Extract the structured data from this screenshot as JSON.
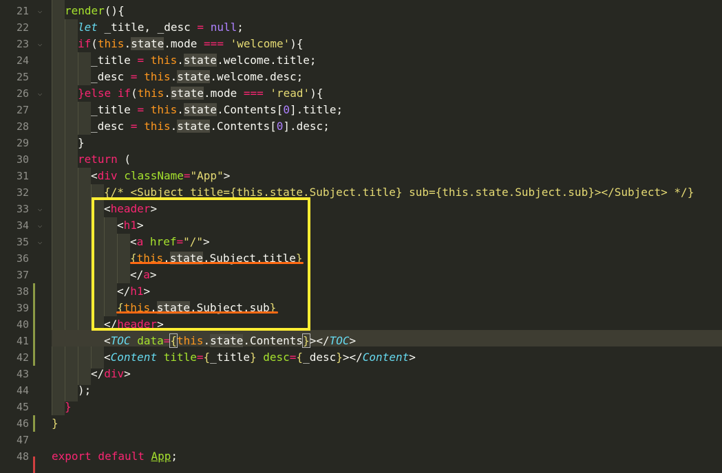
{
  "editor": {
    "theme_colors": {
      "background": "#272822",
      "keyword": "#f92672",
      "function": "#a6e22e",
      "this": "#fd971f",
      "string": "#e6db74",
      "number": "#ae81ff",
      "component": "#66d9ef"
    },
    "line_numbers": [
      "21",
      "22",
      "23",
      "24",
      "25",
      "26",
      "27",
      "28",
      "29",
      "30",
      "31",
      "32",
      "33",
      "34",
      "35",
      "36",
      "37",
      "38",
      "39",
      "40",
      "41",
      "42",
      "43",
      "44",
      "45",
      "46",
      "47",
      "48"
    ],
    "annotations": {
      "highlight_box_color": "#ffee33",
      "underline_color": "#ff6a13"
    },
    "tokens": {
      "render": "render",
      "paren_brace": "(){",
      "let": "let",
      "decl": " _title, _desc ",
      "eq": "=",
      "null": "null",
      "semi": ";",
      "if": "if",
      "paren_open": "(",
      "this": "this",
      "dot": ".",
      "state": "state",
      "mode_seq": ".mode ",
      "strict_eq": "===",
      "welcome_str": "'welcome'",
      "paren_close_brace": "){",
      "title_assign_lhs": "_title ",
      "desc_assign_lhs": "_desc ",
      "welcome_title": ".welcome.title;",
      "welcome_desc": ".welcome.desc;",
      "else_if": "}else if",
      "read_str": "'read'",
      "contents_open": ".Contents[",
      "zero": "0",
      "contents_title": "].title;",
      "contents_desc": "].desc;",
      "close_brace": "}",
      "return": "return",
      "return_paren": " (",
      "lt": "<",
      "gt": ">",
      "div": "div",
      "classname_attr": "className",
      "app_str": "\"App\"",
      "comment_line": "{/* <Subject title={this.state.Subject.title} sub={this.state.Subject.sub}></Subject> */}",
      "header": "header",
      "h1": "h1",
      "a": "a",
      "href_attr": "href",
      "slash_str": "\"/\"",
      "open_brace": "{",
      "subject_title": ".Subject.title",
      "close_tag_open": "</",
      "subject_sub": ".Subject.sub",
      "toc": "TOC",
      "data_attr": "data",
      "contents_plain": ".Contents",
      "content": "Content",
      "title_attr": "title",
      "desc_attr": "desc",
      "title_var": "_title",
      "desc_var": "_desc",
      "close_paren_semi": ");",
      "export_default": "export default ",
      "app_name": "App",
      "space": " "
    }
  }
}
